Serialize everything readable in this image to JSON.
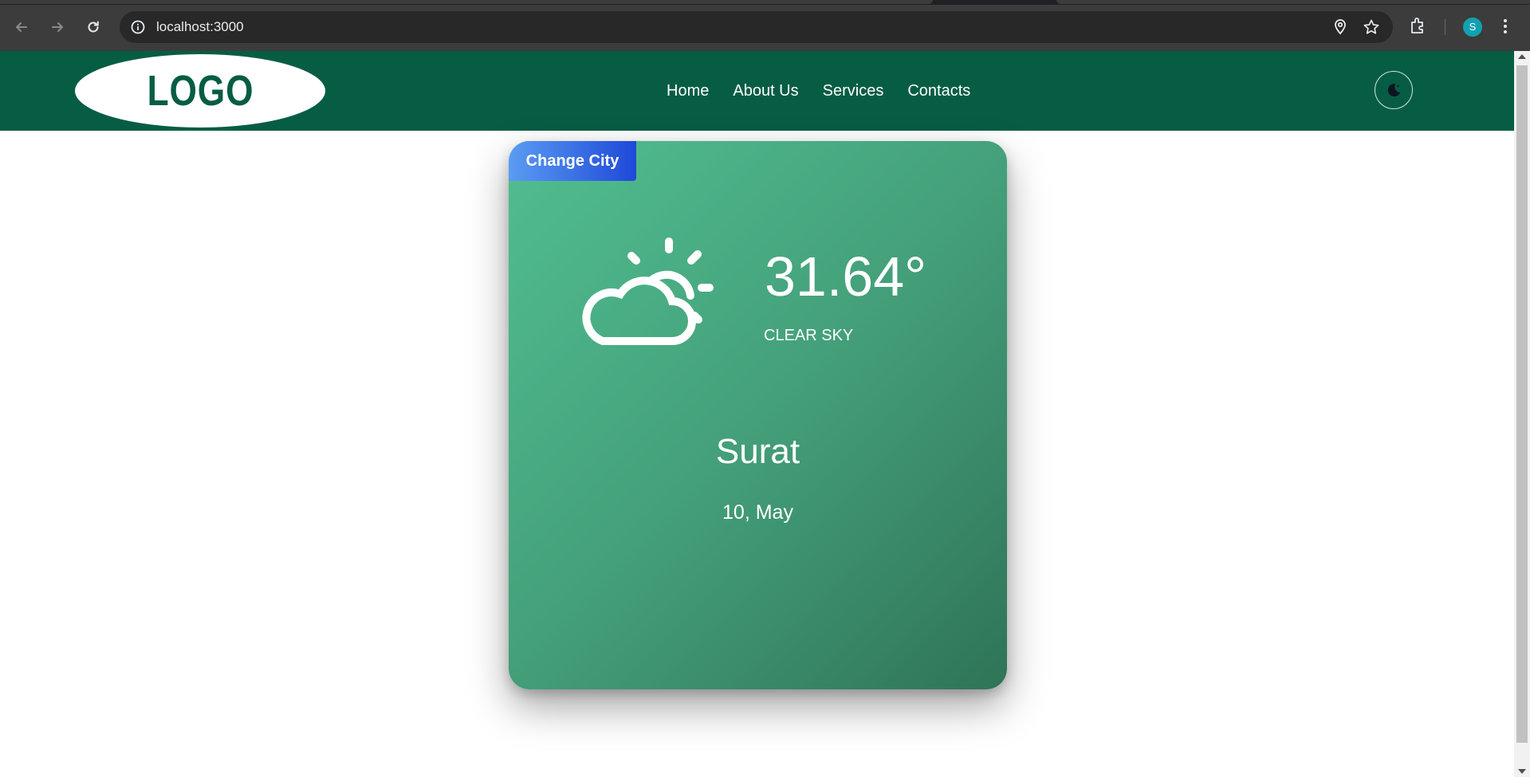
{
  "browser": {
    "url": "localhost:3000",
    "profile_initial": "S",
    "accent": "#12a1b1"
  },
  "header": {
    "logo_text": "LOGO",
    "nav": [
      {
        "label": "Home"
      },
      {
        "label": "About Us"
      },
      {
        "label": "Services"
      },
      {
        "label": "Contacts"
      }
    ],
    "theme_toggle_icon": "moon-icon",
    "brand_color": "#065d44"
  },
  "weather": {
    "change_city_label": "Change City",
    "icon": "partly-cloudy-icon",
    "temperature": "31.64°",
    "condition": "CLEAR SKY",
    "city": "Surat",
    "date": "10, May"
  }
}
